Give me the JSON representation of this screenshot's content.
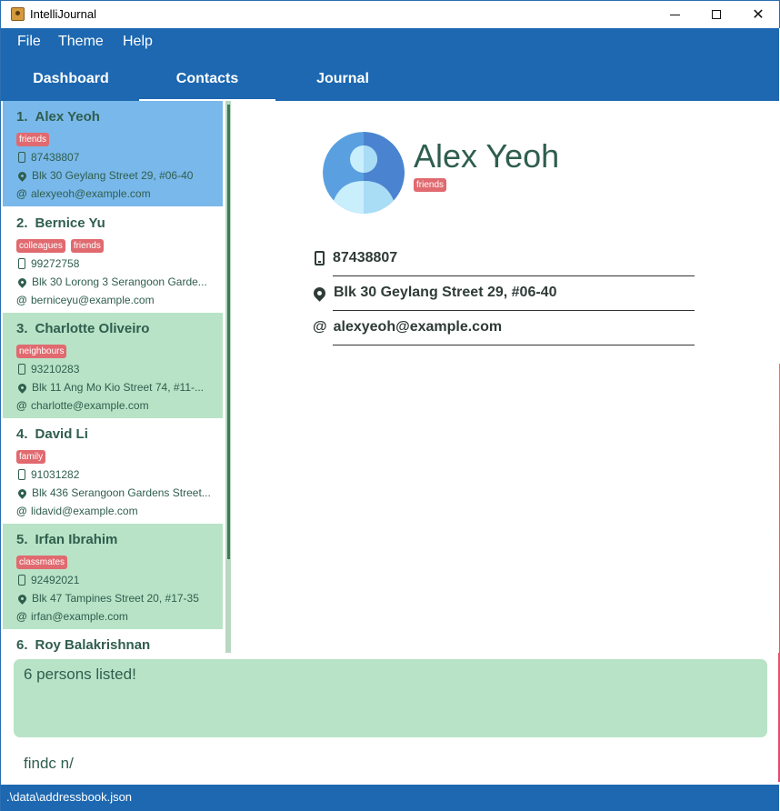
{
  "window": {
    "title": "IntelliJournal",
    "minimize_icon": "minimize-icon",
    "maximize_icon": "maximize-icon",
    "close_icon": "close-icon"
  },
  "menu": {
    "items": [
      "File",
      "Theme",
      "Help"
    ]
  },
  "tabs": [
    {
      "label": "Dashboard",
      "active": false
    },
    {
      "label": "Contacts",
      "active": true
    },
    {
      "label": "Journal",
      "active": false
    }
  ],
  "contacts": [
    {
      "index": "1.",
      "name": "Alex Yeoh",
      "tags": [
        "friends"
      ],
      "phone": "87438807",
      "address": "Blk 30 Geylang Street 29, #06-40",
      "email": "alexyeoh@example.com",
      "selected": true
    },
    {
      "index": "2.",
      "name": "Bernice Yu",
      "tags": [
        "colleagues",
        "friends"
      ],
      "phone": "99272758",
      "address": "Blk 30 Lorong 3 Serangoon Garde...",
      "email": "berniceyu@example.com",
      "selected": false
    },
    {
      "index": "3.",
      "name": "Charlotte Oliveiro",
      "tags": [
        "neighbours"
      ],
      "phone": "93210283",
      "address": "Blk 11 Ang Mo Kio Street 74, #11-...",
      "email": "charlotte@example.com",
      "selected": false
    },
    {
      "index": "4.",
      "name": "David Li",
      "tags": [
        "family"
      ],
      "phone": "91031282",
      "address": "Blk 436 Serangoon Gardens Street...",
      "email": "lidavid@example.com",
      "selected": false
    },
    {
      "index": "5.",
      "name": "Irfan Ibrahim",
      "tags": [
        "classmates"
      ],
      "phone": "92492021",
      "address": "Blk 47 Tampines Street 20, #17-35",
      "email": "irfan@example.com",
      "selected": false
    },
    {
      "index": "6.",
      "name": "Roy Balakrishnan",
      "tags": [],
      "phone": "",
      "address": "",
      "email": "",
      "selected": false
    }
  ],
  "detail": {
    "name": "Alex Yeoh",
    "tags": [
      "friends"
    ],
    "phone": "87438807",
    "address": "Blk 30 Geylang Street 29, #06-40",
    "email": "alexyeoh@example.com"
  },
  "result": {
    "message": "6 persons listed!"
  },
  "command": {
    "value": "findc n/"
  },
  "status": {
    "path": ".\\data\\addressbook.json"
  },
  "colors": {
    "primary": "#1d68b0",
    "selected_card": "#79b8ea",
    "alt_card": "#b8e3c7",
    "tag": "#e06a6f",
    "text_green": "#2f5e4e"
  }
}
